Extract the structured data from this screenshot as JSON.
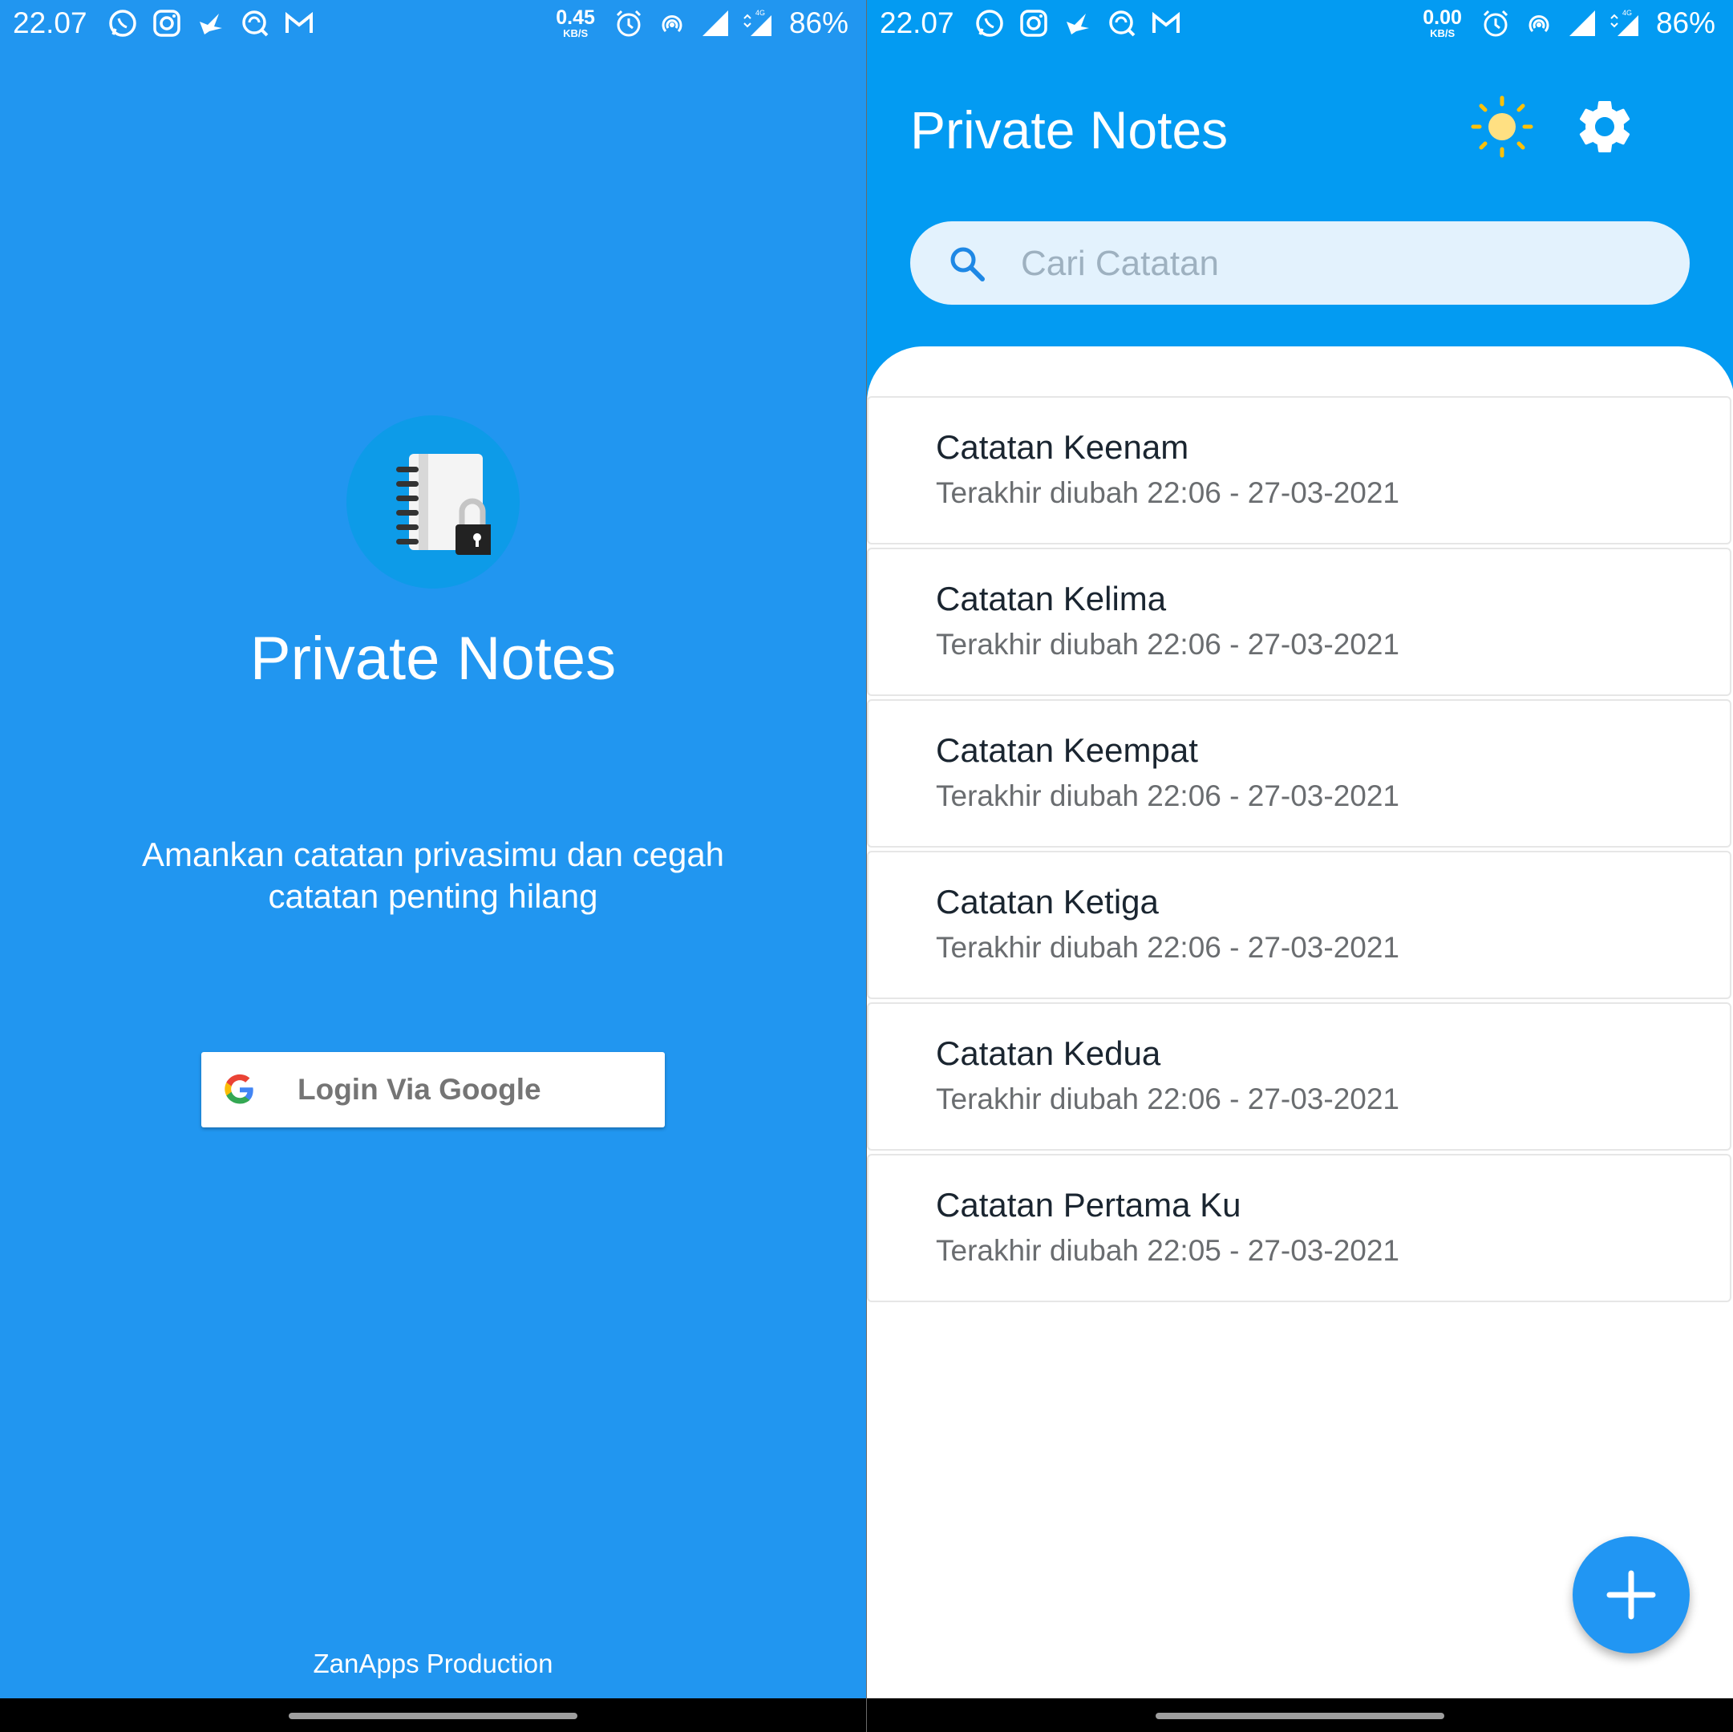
{
  "status_bar_left": {
    "time": "22.07",
    "net_speed_value": "0.45",
    "net_speed_unit": "KB/S",
    "battery": "86%",
    "icons": [
      "whatsapp-icon",
      "instagram-icon",
      "bird-app-icon",
      "search-app-icon",
      "gmail-icon",
      "alarm-icon",
      "hotspot-icon",
      "signal-icon",
      "4g-signal-icon"
    ]
  },
  "status_bar_right": {
    "time": "22.07",
    "net_speed_value": "0.00",
    "net_speed_unit": "KB/S",
    "battery": "86%",
    "network_badge": "4G"
  },
  "login_screen": {
    "app_title": "Private Notes",
    "tagline": "Amankan catatan privasimu dan cegah catatan penting hilang",
    "google_button_label": "Login Via Google",
    "footer": "ZanApps Production",
    "background_color": "#2196F0"
  },
  "notes_screen": {
    "app_title": "Private Notes",
    "search_placeholder": "Cari Catatan",
    "accent_color": "#039BF2",
    "notes": [
      {
        "title": "Catatan Keenam",
        "subtitle": "Terakhir diubah 22:06 - 27-03-2021"
      },
      {
        "title": "Catatan Kelima",
        "subtitle": "Terakhir diubah 22:06 - 27-03-2021"
      },
      {
        "title": "Catatan Keempat",
        "subtitle": "Terakhir diubah 22:06 - 27-03-2021"
      },
      {
        "title": "Catatan Ketiga",
        "subtitle": "Terakhir diubah 22:06 - 27-03-2021"
      },
      {
        "title": "Catatan Kedua",
        "subtitle": "Terakhir diubah 22:06 - 27-03-2021"
      },
      {
        "title": "Catatan Pertama Ku",
        "subtitle": "Terakhir diubah 22:05 - 27-03-2021"
      }
    ]
  }
}
